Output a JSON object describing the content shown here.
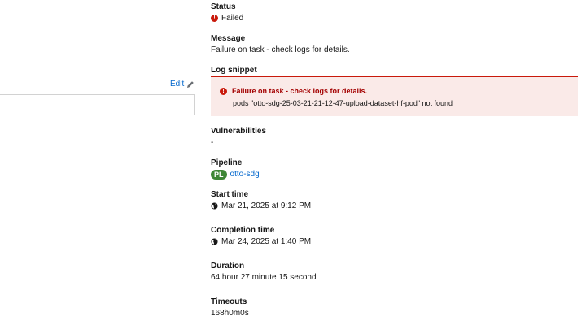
{
  "left": {
    "edit_label": "Edit"
  },
  "status": {
    "term": "Status",
    "value": "Failed"
  },
  "message": {
    "term": "Message",
    "value": "Failure on task - check logs for details."
  },
  "log_snippet": {
    "term": "Log snippet",
    "alert_title": "Failure on task - check logs for details.",
    "alert_body": "pods \"otto-sdg-25-03-21-21-12-47-upload-dataset-hf-pod\" not found"
  },
  "vulnerabilities": {
    "term": "Vulnerabilities",
    "value": "-"
  },
  "pipeline": {
    "term": "Pipeline",
    "badge": "PL",
    "value": "otto-sdg"
  },
  "start_time": {
    "term": "Start time",
    "value": "Mar 21, 2025 at 9:12 PM"
  },
  "completion_time": {
    "term": "Completion time",
    "value": "Mar 24, 2025 at 1:40 PM"
  },
  "duration": {
    "term": "Duration",
    "value": "64 hour 27 minute 15 second"
  },
  "timeouts": {
    "term": "Timeouts",
    "value": "168h0m0s"
  },
  "colors": {
    "danger": "#c9190b",
    "link": "#0066cc",
    "pipeline_badge": "#3e8635",
    "alert_bg": "#faeae8"
  }
}
